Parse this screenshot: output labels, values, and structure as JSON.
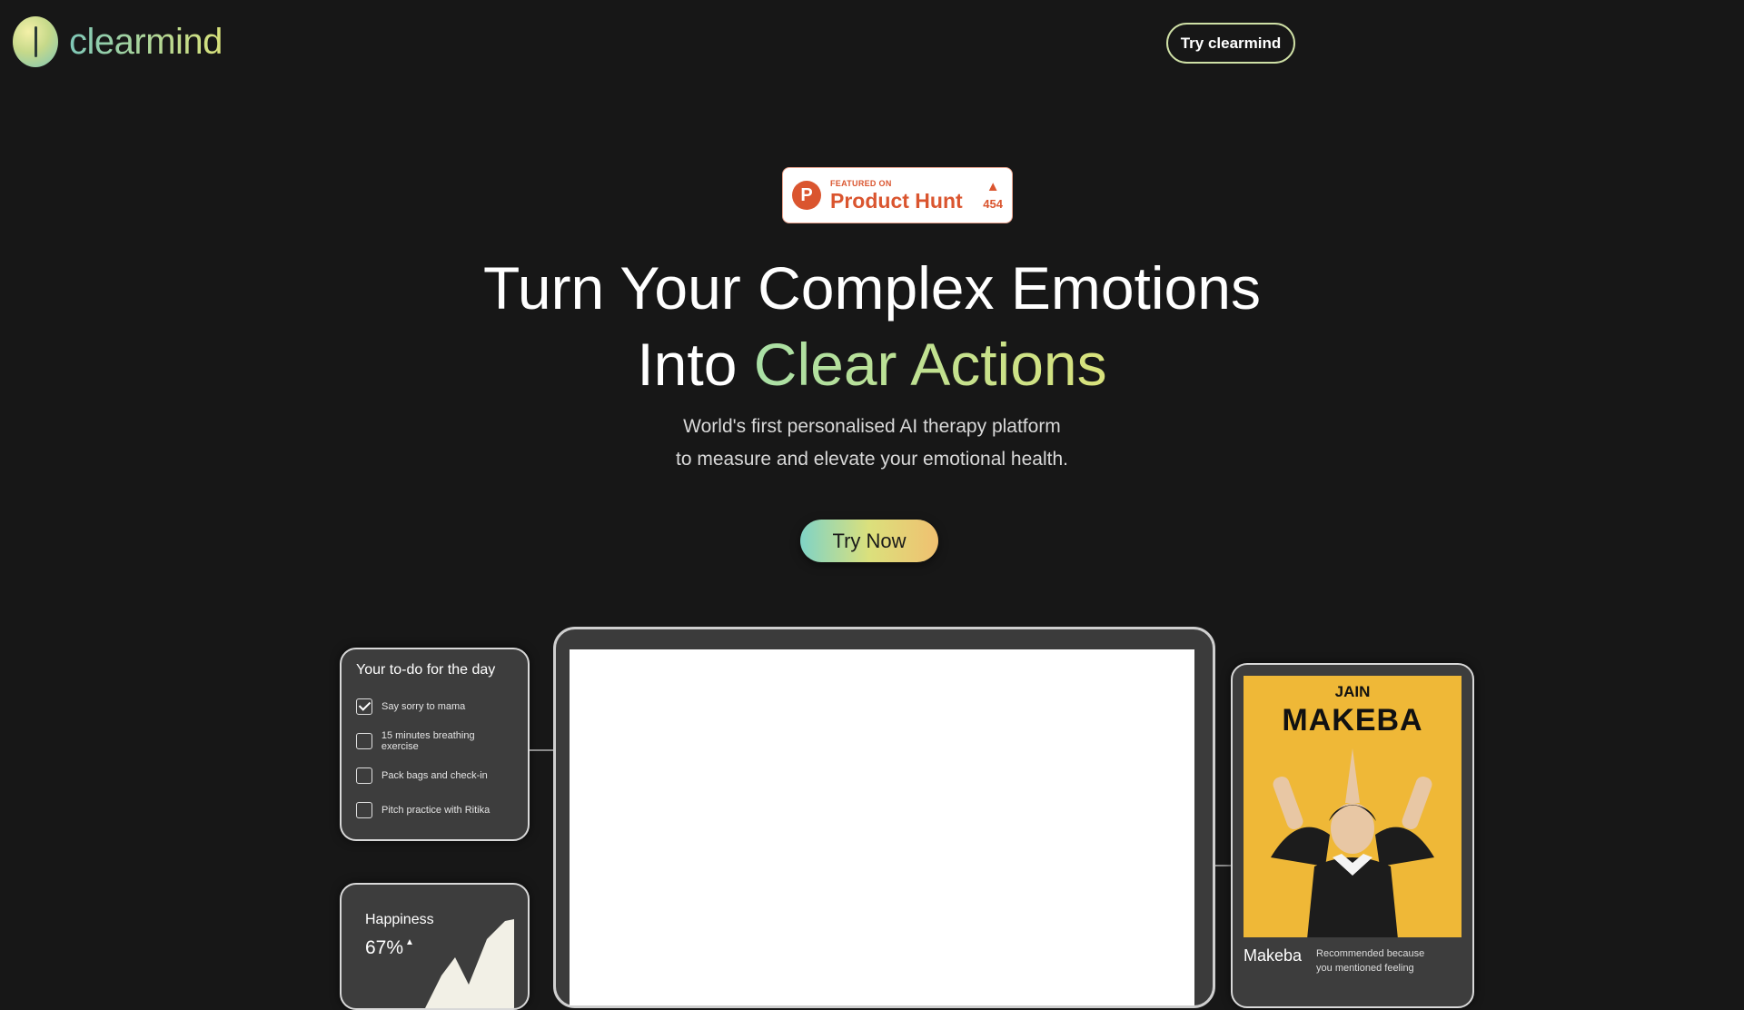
{
  "header": {
    "logo_text": "clearmind",
    "nav_button": "Try clearmind"
  },
  "badge": {
    "featured": "FEATURED ON",
    "name": "Product Hunt",
    "votes": "454"
  },
  "hero": {
    "line1": "Turn Your Complex Emotions",
    "line2_plain": "Into",
    "line2_accent": "Clear Actions",
    "sub1": "World's first personalised AI therapy platform",
    "sub2": "to measure and elevate your emotional health.",
    "cta": "Try Now"
  },
  "todo": {
    "title": "Your to-do for the day",
    "items": [
      {
        "label": "Say sorry to mama",
        "checked": true
      },
      {
        "label": "15 minutes breathing exercise",
        "checked": false
      },
      {
        "label": "Pack bags and check-in",
        "checked": false
      },
      {
        "label": "Pitch practice with Ritika",
        "checked": false
      }
    ]
  },
  "happiness": {
    "title": "Happiness",
    "value": "67%"
  },
  "movie": {
    "poster_top": "JAIN",
    "poster_title": "MAKEBA",
    "name": "Makeba",
    "desc1": "Recommended because",
    "desc2": "you mentioned feeling"
  },
  "colors": {
    "background": "#171717",
    "accent_start": "#7fc8b8",
    "accent_end": "#d9e27b",
    "product_hunt": "#da552f",
    "poster": "#efb837"
  }
}
